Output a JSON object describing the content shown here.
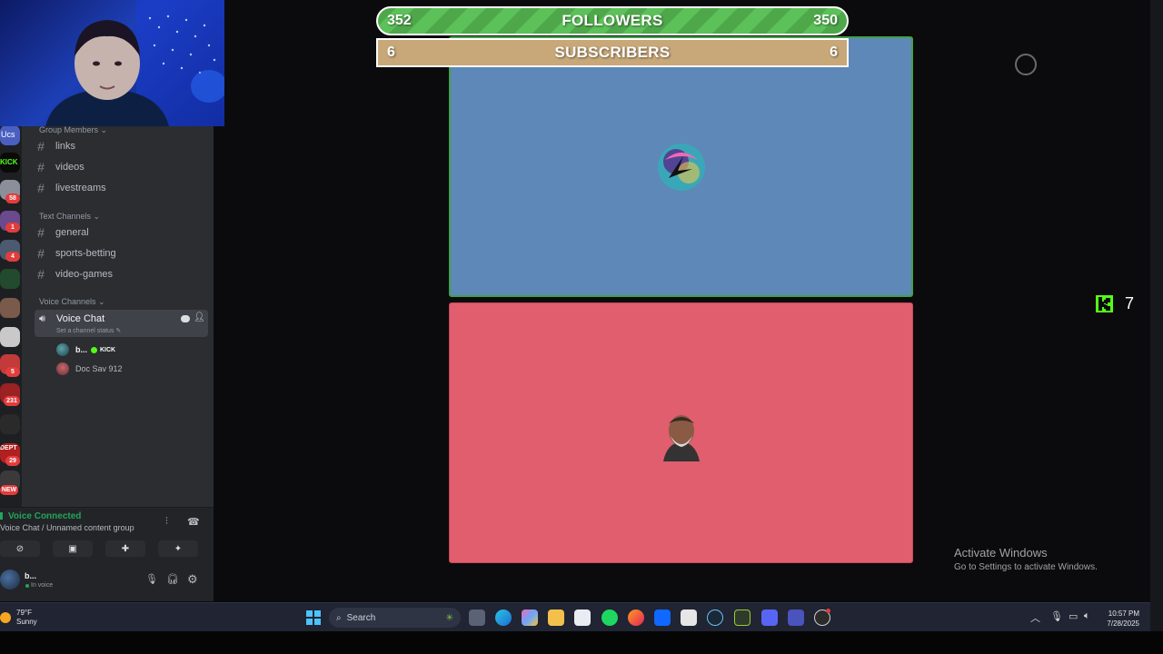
{
  "overlay": {
    "followers": {
      "current": "352",
      "label": "FOLLOWERS",
      "goal": "350"
    },
    "subscribers": {
      "current": "6",
      "label": "SUBSCRIBERS",
      "goal": "6"
    },
    "kick_viewers": "7"
  },
  "discord": {
    "server_badges": [
      "58",
      "1",
      "4",
      "5",
      "231",
      "29"
    ],
    "server_labels": {
      "kick_server": "KICK",
      "new_badge": "NEW",
      "top_server": "Ucs",
      "dept_server": "DEPT"
    },
    "categories": {
      "group_members": "Group Members ⌄",
      "text_channels": "Text Channels ⌄",
      "voice_channels": "Voice Channels ⌄"
    },
    "group_channels": [
      "links",
      "videos",
      "livestreams"
    ],
    "text_channels": [
      "general",
      "sports-betting",
      "video-games"
    ],
    "voice_channel": {
      "name": "Voice Chat",
      "status": "Set a channel status ✎"
    },
    "voice_users": [
      {
        "name": "b...",
        "tag": "KICK"
      },
      {
        "name": "Doc Sav 912"
      }
    ],
    "voice_panel": {
      "connected": "Voice Connected",
      "location": "Voice Chat / Unnamed content group"
    },
    "user": {
      "name": "b...",
      "status": "In voice"
    }
  },
  "windows": {
    "activate_title": "Activate Windows",
    "activate_sub": "Go to Settings to activate Windows."
  },
  "taskbar": {
    "weather_temp": "79°F",
    "weather_cond": "Sunny",
    "search_placeholder": "Search",
    "time": "10:57 PM",
    "date": "7/28/2025"
  },
  "colors": {
    "discord_green": "#23a55a",
    "kick_green": "#53fc18",
    "tile_blue": "#5d88b7",
    "tile_red": "#e05e6d",
    "followers_green": "#4ea84a",
    "subs_tan": "#c8a878"
  }
}
